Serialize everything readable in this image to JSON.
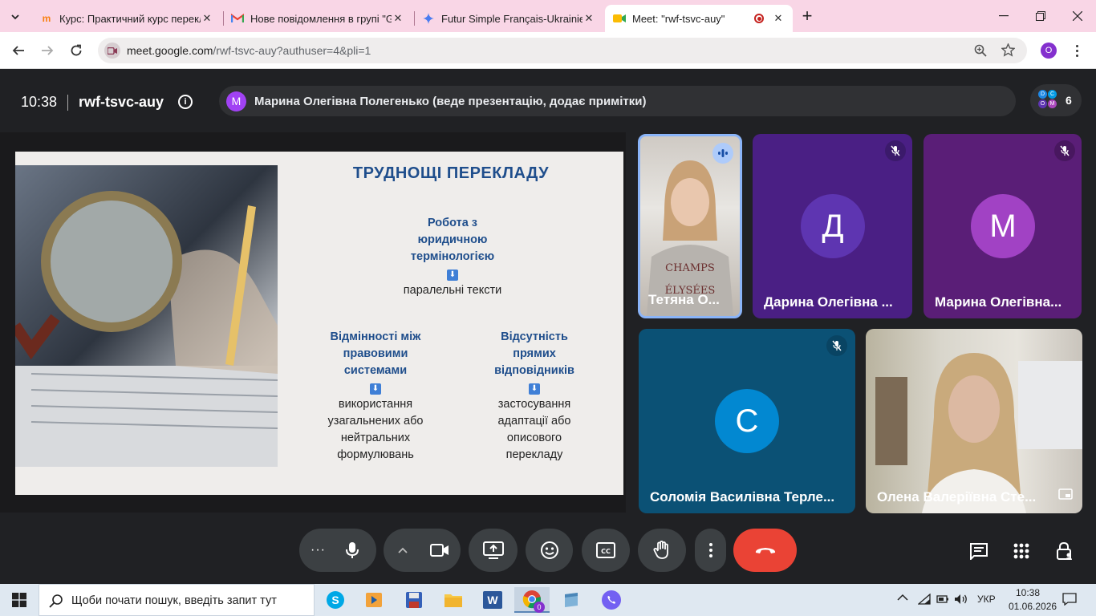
{
  "browser": {
    "tabs": [
      {
        "title": "Курс: Практичний курс перекл",
        "icon": "moodle-icon"
      },
      {
        "title": "Нове повідомлення в групі \"G",
        "icon": "gmail-icon"
      },
      {
        "title": "Futur Simple Français-Ukrainien",
        "icon": "gemini-icon"
      },
      {
        "title": "Meet: \"rwf-tsvc-auy\"",
        "icon": "meet-icon"
      }
    ],
    "new_tab": "+",
    "url_host": "meet.google.com",
    "url_path": "/rwf-tsvc-auy?authuser=4&pli=1",
    "profile_initial": "O"
  },
  "meet": {
    "time": "10:38",
    "code": "rwf-tsvc-auy",
    "presenter_initial": "M",
    "presenter_text": "Марина Олегівна Полегенько (веде презентацію, додає примітки)",
    "participant_count": "6",
    "mini_avatars": [
      "D",
      "C",
      "O",
      "M"
    ]
  },
  "slide": {
    "title": "ТРУДНОЩІ ПЕРЕКЛАДУ",
    "block1": {
      "h1": "Робота з",
      "h2": "юридичною",
      "h3": "термінологією",
      "b1": "паралельні тексти"
    },
    "block2": {
      "h1": "Відмінності між",
      "h2": "правовими",
      "h3": "системами",
      "b1": "використання",
      "b2": "узагальнених або",
      "b3": "нейтральних",
      "b4": "формулювань"
    },
    "block3": {
      "h1": "Відсутність",
      "h2": "прямих",
      "h3": "відповідників",
      "b1": "застосування",
      "b2": "адаптації або",
      "b3": "описового",
      "b4": "перекладу"
    },
    "arrow": "⬇"
  },
  "tiles": [
    {
      "name": "Тетяна О...",
      "initial": ""
    },
    {
      "name": "Дарина Олегівна ...",
      "initial": "Д"
    },
    {
      "name": "Марина Олегівна...",
      "initial": "М"
    },
    {
      "name": "Соломія Василівна Терле...",
      "initial": "С"
    },
    {
      "name": "Олена Валеріївна Сте...",
      "initial": ""
    }
  ],
  "taskbar": {
    "search_placeholder": "Щоби почати пошук, введіть запит тут",
    "lang": "УКР",
    "clock_time": "10:38",
    "clock_date": "01.06.2026",
    "chrome_badge": "0"
  },
  "colors": {
    "accent_red": "#ea4335",
    "meet_bg": "#202124",
    "slide_heading": "#1f4e8c"
  }
}
